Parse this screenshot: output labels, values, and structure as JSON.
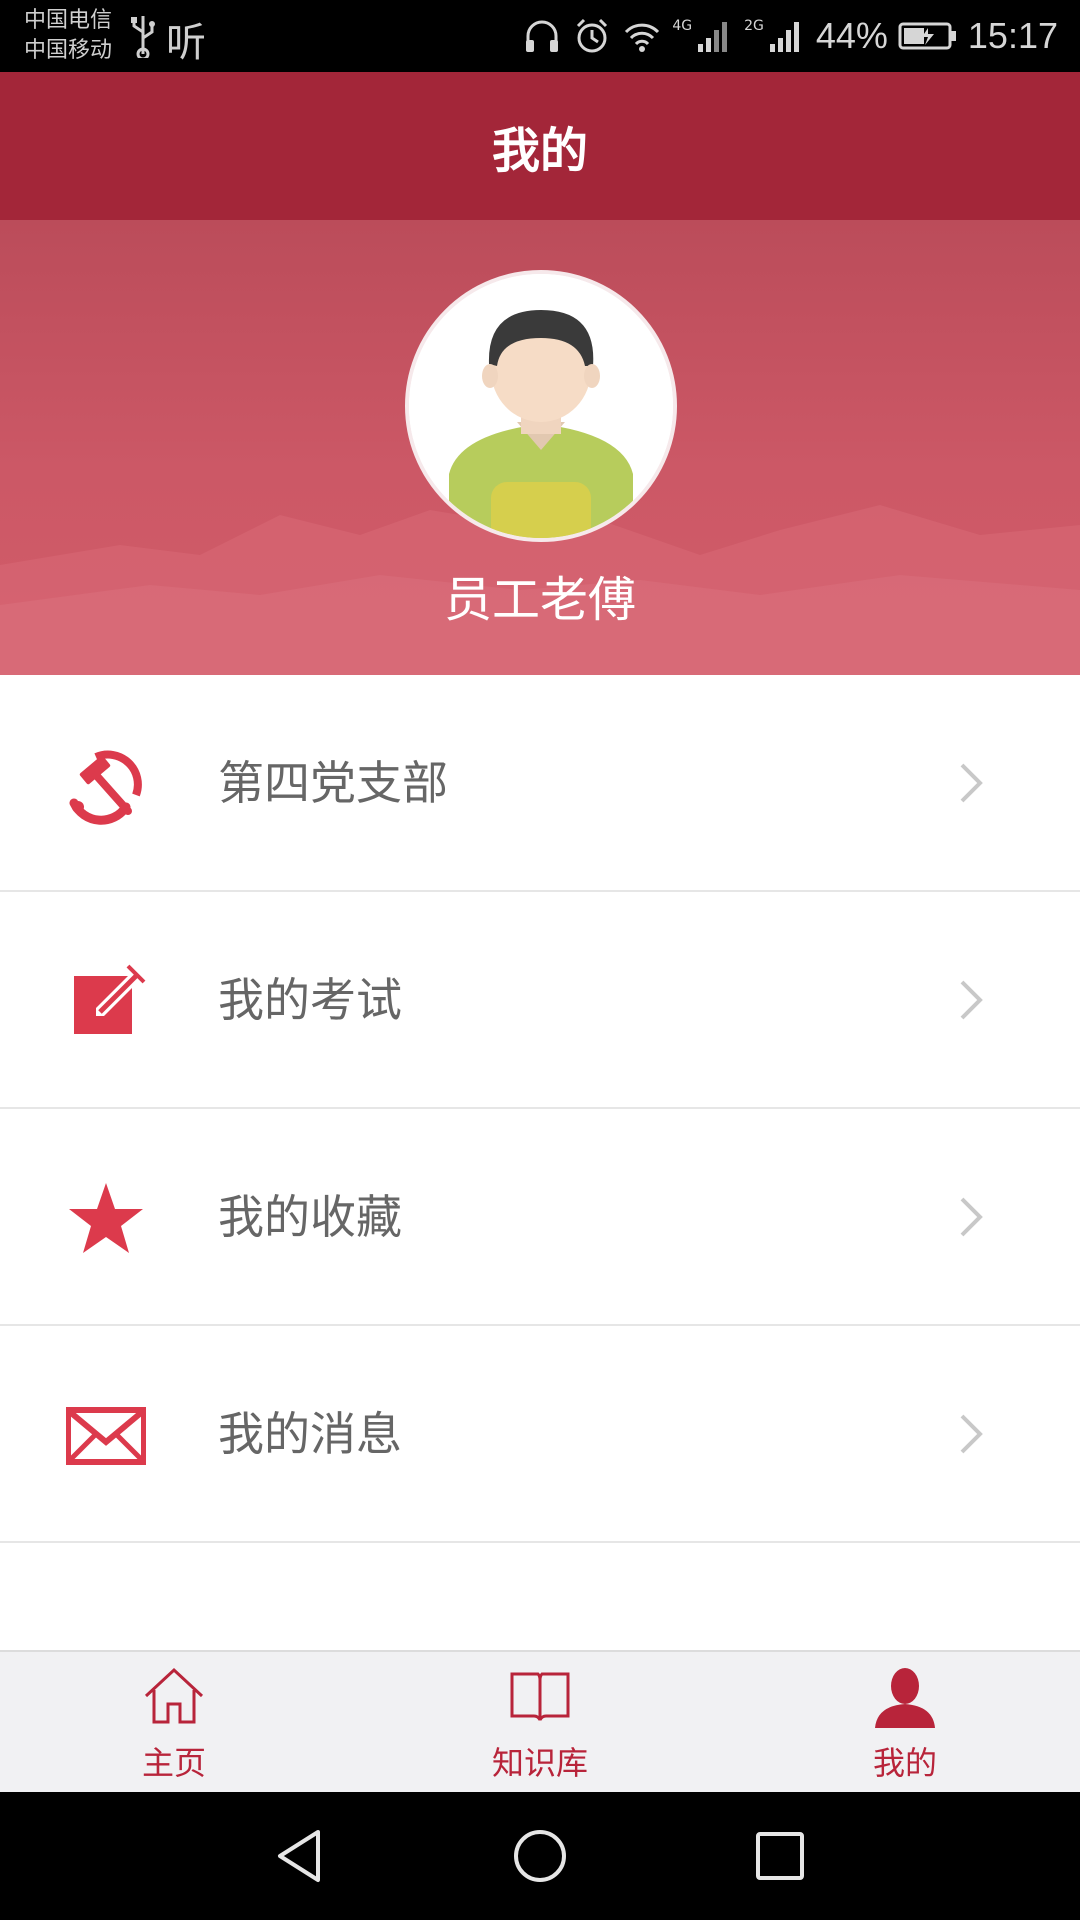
{
  "status_bar": {
    "carrier_1": "中国电信",
    "carrier_2": "中国移动",
    "listen_glyph": "听",
    "network_1": "4G",
    "network_2": "2G",
    "battery_percent": "44%",
    "time": "15:17"
  },
  "header": {
    "title": "我的"
  },
  "profile": {
    "username": "员工老傅"
  },
  "menu": {
    "items": [
      {
        "label": "第四党支部",
        "icon": "hammer-sickle-icon"
      },
      {
        "label": "我的考试",
        "icon": "edit-note-icon"
      },
      {
        "label": "我的收藏",
        "icon": "star-icon"
      },
      {
        "label": "我的消息",
        "icon": "envelope-icon"
      }
    ]
  },
  "tabbar": {
    "tabs": [
      {
        "label": "主页",
        "icon": "home-icon"
      },
      {
        "label": "知识库",
        "icon": "book-icon"
      },
      {
        "label": "我的",
        "icon": "user-icon",
        "active": true
      }
    ]
  },
  "colors": {
    "primary": "#a32639",
    "accent": "#dc3a4c",
    "banner": "#cc5866"
  }
}
